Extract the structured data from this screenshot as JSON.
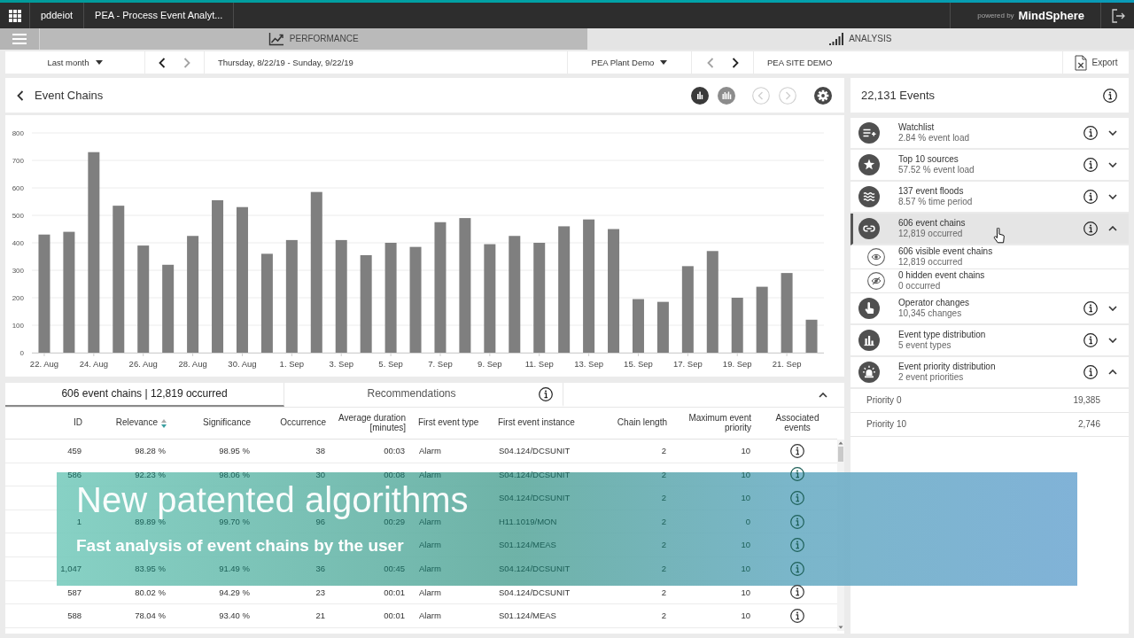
{
  "top_bar": {
    "tenant": "pddeiot",
    "app_title": "PEA - Process Event Analyt...",
    "powered_by": "powered by",
    "brand": "MindSphere"
  },
  "nav_tabs": [
    {
      "kind": "performance",
      "label": "PERFORMANCE",
      "selected": false
    },
    {
      "kind": "analysis",
      "label": "ANALYSIS",
      "selected": true
    }
  ],
  "filters": {
    "period": "Last month",
    "date_nav": [
      {
        "disabled": false
      },
      {
        "disabled": true
      }
    ],
    "date_range": "Thursday, 8/22/19 - Sunday, 9/22/19",
    "plant": "PEA Plant Demo",
    "plant_nav": [
      {
        "disabled": true
      },
      {
        "disabled": false
      }
    ],
    "site": "PEA SITE DEMO",
    "export": "Export"
  },
  "chart_panel": {
    "title": "Event Chains",
    "view_buttons": [
      {
        "kind": "bars",
        "selected": true
      },
      {
        "kind": "grouped",
        "selected": false
      }
    ],
    "page_buttons": [
      {
        "disabled": true
      },
      {
        "disabled": true
      }
    ],
    "chart_data": [
      {
        "type": "bar",
        "categories": [
          "22. Aug",
          null,
          "24. Aug",
          null,
          "26. Aug",
          null,
          "28. Aug",
          null,
          "30. Aug",
          null,
          "1. Sep",
          null,
          "3. Sep",
          null,
          "5. Sep",
          null,
          "7. Sep",
          null,
          "9. Sep",
          null,
          "11. Sep",
          null,
          "13. Sep",
          null,
          "15. Sep",
          null,
          "17. Sep",
          null,
          "19. Sep",
          null,
          "21. Sep",
          null
        ],
        "values": [
          430,
          440,
          730,
          535,
          390,
          320,
          425,
          555,
          530,
          360,
          410,
          585,
          410,
          355,
          400,
          385,
          475,
          490,
          395,
          425,
          400,
          460,
          485,
          450,
          195,
          185,
          315,
          370,
          200,
          240,
          290,
          120
        ],
        "color": "#7f7f7f",
        "ylim": [
          0,
          800
        ],
        "yticks": [
          0,
          100,
          200,
          300,
          400,
          500,
          600,
          700,
          800
        ],
        "grid": true
      }
    ]
  },
  "table": {
    "tabs": [
      {
        "label": "606 event chains | 12,819 occurred",
        "selected": true
      },
      {
        "label": "Recommendations",
        "selected": false
      }
    ],
    "columns": [
      {
        "label": "ID",
        "sorted": false
      },
      {
        "label": "Relevance",
        "sorted": true
      },
      {
        "label": "Significance",
        "sorted": false
      },
      {
        "label": "Occurrence",
        "sorted": false
      },
      {
        "label": "Average duration [minutes]",
        "sorted": false
      },
      {
        "label": "First event type",
        "sorted": false
      },
      {
        "label": "First event instance",
        "sorted": false
      },
      {
        "label": "Chain length",
        "sorted": false
      },
      {
        "label": "Maximum event priority",
        "sorted": false
      },
      {
        "label": "Associated events",
        "sorted": false
      }
    ],
    "rows": [
      {
        "cells": [
          "459",
          "98.28 %",
          "98.95 %",
          "38",
          "00:03",
          "Alarm",
          "S04.124/DCSUNIT",
          "2",
          "10"
        ]
      },
      {
        "cells": [
          "586",
          "92.23 %",
          "98.06 %",
          "30",
          "00:08",
          "Alarm",
          "S04.124/DCSUNIT",
          "2",
          "10"
        ]
      },
      {
        "cells": [
          null,
          null,
          null,
          null,
          null,
          null,
          "S04.124/DCSUNIT",
          "2",
          "10"
        ]
      },
      {
        "cells": [
          "1",
          "89.89 %",
          "99.70 %",
          "96",
          "00:29",
          "Alarm",
          "H11.1019/MON",
          "2",
          "0"
        ]
      },
      {
        "cells": [
          null,
          null,
          null,
          null,
          null,
          "Alarm",
          "S01.124/MEAS",
          "2",
          "10"
        ]
      },
      {
        "cells": [
          "1,047",
          "83.95 %",
          "91.49 %",
          "36",
          "00:45",
          "Alarm",
          "S04.124/DCSUNIT",
          "2",
          "10"
        ]
      },
      {
        "cells": [
          "587",
          "80.02 %",
          "94.29 %",
          "23",
          "00:01",
          "Alarm",
          "S04.124/DCSUNIT",
          "2",
          "10"
        ]
      },
      {
        "cells": [
          "588",
          "78.04 %",
          "93.40 %",
          "21",
          "00:01",
          "Alarm",
          "S01.124/MEAS",
          "2",
          "10"
        ]
      }
    ]
  },
  "events_panel": {
    "title": "22,131 Events",
    "items": [
      {
        "kind": "watchlist",
        "title": "Watchlist",
        "subtitle": "2.84 % event load",
        "selected": false,
        "expanded": false
      },
      {
        "kind": "sources",
        "title": "Top 10 sources",
        "subtitle": "57.52 % event load",
        "selected": false,
        "expanded": false
      },
      {
        "kind": "floods",
        "title": "137 event floods",
        "subtitle": "8.57 % time period",
        "selected": false,
        "expanded": false
      },
      {
        "kind": "chains",
        "title": "606 event chains",
        "subtitle": "12,819 occurred",
        "selected": true,
        "expanded": true,
        "children": [
          {
            "kind": "visible",
            "title": "606 visible event chains",
            "subtitle": "12,819 occurred"
          },
          {
            "kind": "hidden",
            "title": "0 hidden event chains",
            "subtitle": "0 occurred"
          }
        ]
      },
      {
        "kind": "operator",
        "title": "Operator changes",
        "subtitle": "10,345 changes",
        "selected": false,
        "expanded": false
      },
      {
        "kind": "types",
        "title": "Event type distribution",
        "subtitle": "5 event types",
        "selected": false,
        "expanded": false
      },
      {
        "kind": "priority",
        "title": "Event priority distribution",
        "subtitle": "2 event priorities",
        "selected": false,
        "expanded": true,
        "children": [
          {
            "kind": "value",
            "title": "Priority 0",
            "value": "19,385"
          },
          {
            "kind": "value",
            "title": "Priority 10",
            "value": "2,746"
          }
        ]
      }
    ]
  },
  "caption": {
    "title": "New patented algorithms",
    "subtitle": "Fast analysis of event chains by the user"
  }
}
